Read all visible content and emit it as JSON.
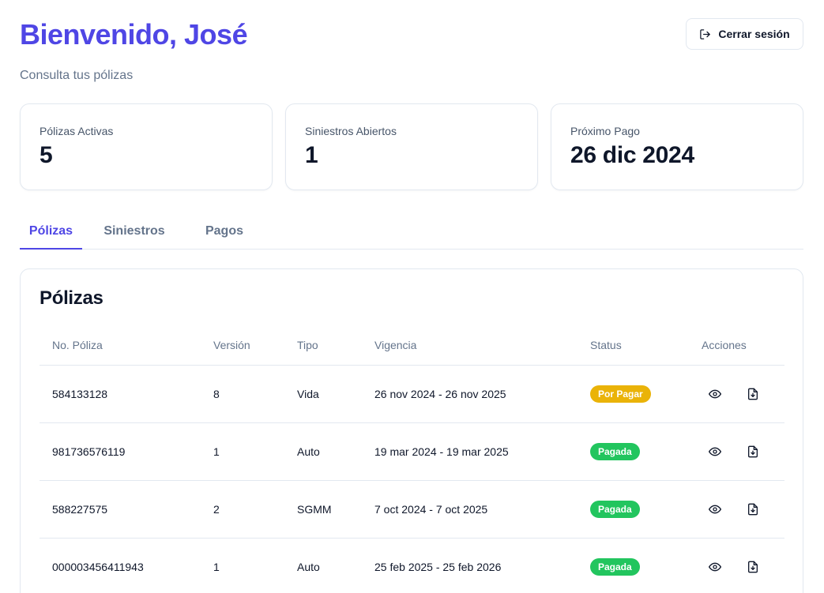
{
  "header": {
    "welcome": "Bienvenido, José",
    "subtitle": "Consulta tus pólizas",
    "logout_label": "Cerrar sesión"
  },
  "stats": [
    {
      "label": "Pólizas Activas",
      "value": "5"
    },
    {
      "label": "Siniestros Abiertos",
      "value": "1"
    },
    {
      "label": "Próximo Pago",
      "value": "26 dic 2024"
    }
  ],
  "tabs": [
    {
      "label": "Pólizas",
      "active": true
    },
    {
      "label": "Siniestros",
      "active": false
    },
    {
      "label": "Pagos",
      "active": false
    }
  ],
  "panel": {
    "title": "Pólizas",
    "columns": [
      "No. Póliza",
      "Versión",
      "Tipo",
      "Vigencia",
      "Status",
      "Acciones"
    ],
    "rows": [
      {
        "numero": "584133128",
        "version": "8",
        "tipo": "Vida",
        "vigencia": "26 nov 2024 - 26 nov 2025",
        "status": "Por Pagar"
      },
      {
        "numero": "981736576119",
        "version": "1",
        "tipo": "Auto",
        "vigencia": "19 mar 2024 - 19 mar 2025",
        "status": "Pagada"
      },
      {
        "numero": "588227575",
        "version": "2",
        "tipo": "SGMM",
        "vigencia": "7 oct 2024 - 7 oct 2025",
        "status": "Pagada"
      },
      {
        "numero": "000003456411943",
        "version": "1",
        "tipo": "Auto",
        "vigencia": "25 feb 2025 - 25 feb 2026",
        "status": "Pagada"
      }
    ]
  },
  "colors": {
    "accent": "#4f46e5",
    "pending": "#eab308",
    "paid": "#22c55e"
  },
  "icons": {
    "logout": "logout-icon",
    "view": "eye-icon",
    "download": "file-download-icon"
  }
}
